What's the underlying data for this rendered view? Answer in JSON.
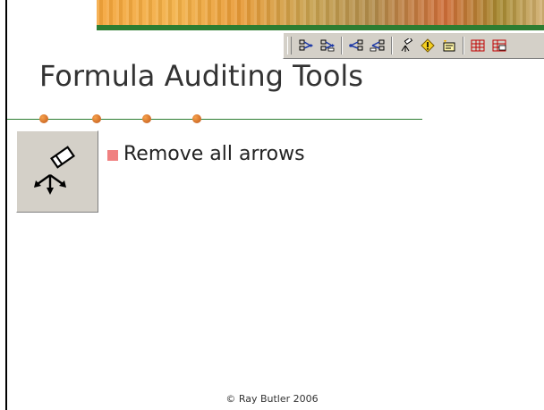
{
  "slide": {
    "title": "Formula Auditing Tools",
    "bullet": "Remove all arrows",
    "footer": "© Ray Butler 2006",
    "accent_green": "#2e7d32",
    "bullet_color": "#f08080",
    "dot_color": "#e07a2a"
  },
  "toolbar": {
    "icons": [
      "trace-precedents-icon",
      "remove-precedent-arrows-icon",
      "trace-dependents-icon",
      "remove-dependent-arrows-icon",
      "remove-all-arrows-icon",
      "trace-error-icon",
      "new-comment-icon",
      "circle-invalid-data-icon",
      "clear-validation-circles-icon"
    ]
  },
  "feature_icon": "remove-all-arrows-icon"
}
